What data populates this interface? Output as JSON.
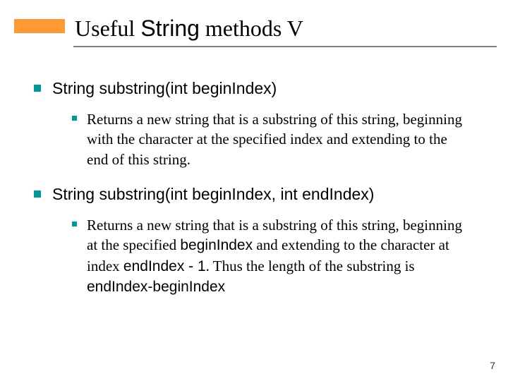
{
  "title": {
    "pre": "Useful ",
    "mono": "String",
    "post": " methods V"
  },
  "sections": [
    {
      "heading": "String substring(int beginIndex)",
      "body_plain": "Returns a new string that is a substring of this string, beginning with the character at the specified index and extending to the end of this string."
    },
    {
      "heading": "String substring(int beginIndex, int endIndex)",
      "body_pre": "Returns a new string that is a substring of this string, beginning at the specified ",
      "body_c1": "beginIndex",
      "body_mid1": " and extending to the character at index ",
      "body_c2": "endIndex - 1",
      "body_mid2": ". Thus the length of the substring is ",
      "body_c3": "endIndex-beginIndex"
    }
  ],
  "page_number": "7"
}
